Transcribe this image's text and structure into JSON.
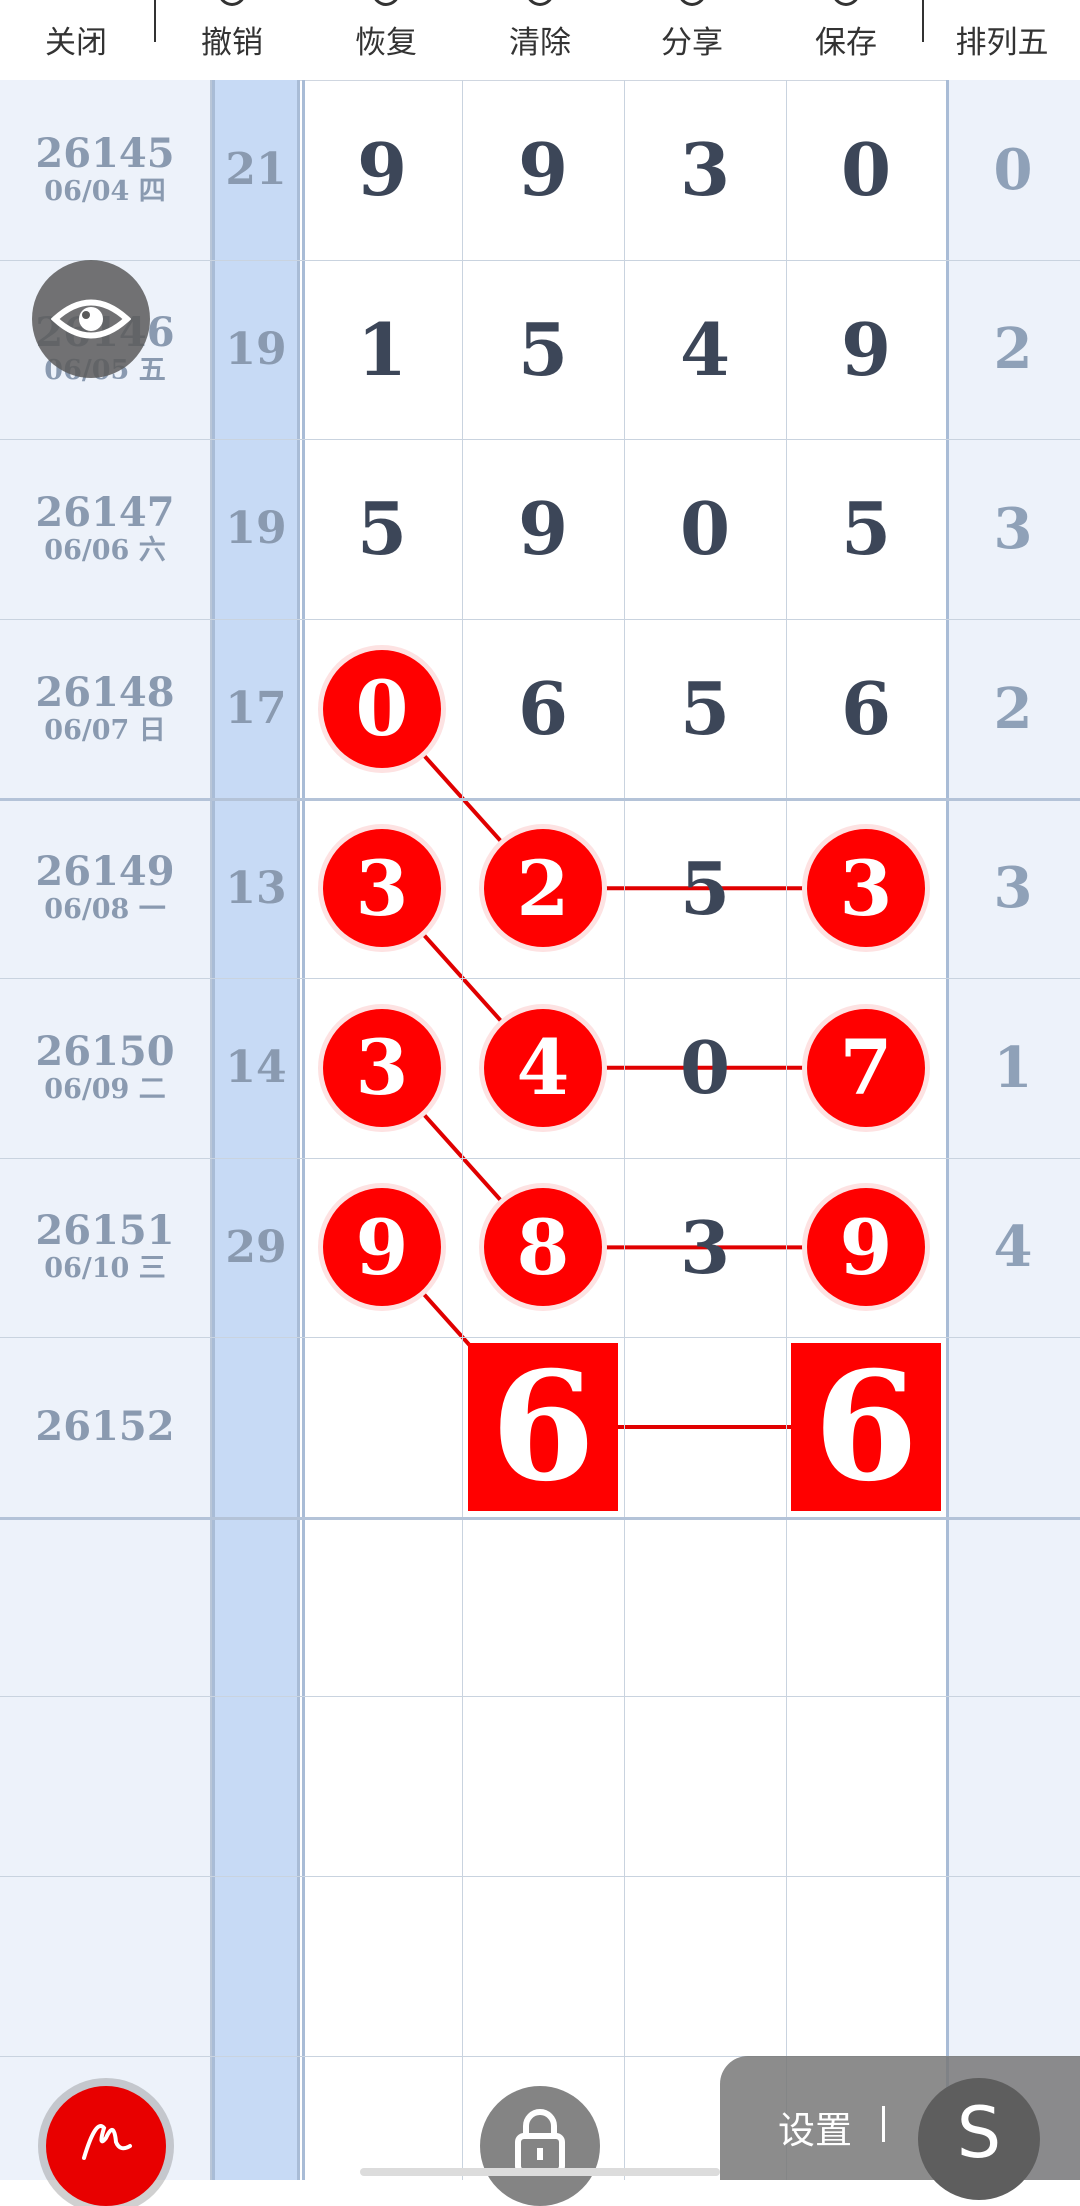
{
  "toolbar": {
    "items": [
      {
        "label": "关闭",
        "icon": "close-icon"
      },
      {
        "label": "撤销",
        "icon": "undo-icon"
      },
      {
        "label": "恢复",
        "icon": "redo-icon"
      },
      {
        "label": "清除",
        "icon": "clear-icon"
      },
      {
        "label": "分享",
        "icon": "share-icon"
      },
      {
        "label": "保存",
        "icon": "save-icon"
      },
      {
        "label": "排列五",
        "icon": ""
      }
    ]
  },
  "rows": [
    {
      "issue": "26145",
      "date": "06/04 四",
      "sum": "21",
      "digits": [
        "9",
        "9",
        "3",
        "0"
      ],
      "fifth": "0",
      "marked": [
        false,
        false,
        false,
        false
      ]
    },
    {
      "issue": "26146",
      "date": "06/05 五",
      "sum": "19",
      "digits": [
        "1",
        "5",
        "4",
        "9"
      ],
      "fifth": "2",
      "marked": [
        false,
        false,
        false,
        false
      ]
    },
    {
      "issue": "26147",
      "date": "06/06 六",
      "sum": "19",
      "digits": [
        "5",
        "9",
        "0",
        "5"
      ],
      "fifth": "3",
      "marked": [
        false,
        false,
        false,
        false
      ]
    },
    {
      "issue": "26148",
      "date": "06/07 日",
      "sum": "17",
      "digits": [
        "0",
        "6",
        "5",
        "6"
      ],
      "fifth": "2",
      "marked": [
        true,
        false,
        false,
        false
      ]
    },
    {
      "issue": "26149",
      "date": "06/08 一",
      "sum": "13",
      "digits": [
        "3",
        "2",
        "5",
        "3"
      ],
      "fifth": "3",
      "marked": [
        true,
        true,
        false,
        true
      ]
    },
    {
      "issue": "26150",
      "date": "06/09 二",
      "sum": "14",
      "digits": [
        "3",
        "4",
        "0",
        "7"
      ],
      "fifth": "1",
      "marked": [
        true,
        true,
        false,
        true
      ]
    },
    {
      "issue": "26151",
      "date": "06/10 三",
      "sum": "29",
      "digits": [
        "9",
        "8",
        "3",
        "9"
      ],
      "fifth": "4",
      "marked": [
        true,
        true,
        false,
        true
      ]
    },
    {
      "issue": "26152",
      "date": "",
      "sum": "",
      "digits": [
        "",
        "6",
        "",
        "6"
      ],
      "fifth": "",
      "marked": [
        false,
        false,
        false,
        false
      ],
      "predicted": [
        false,
        true,
        false,
        true
      ]
    }
  ],
  "controls": {
    "settings_label": "设置",
    "s_label": "S"
  },
  "colors": {
    "accent_red": "#ff0000",
    "sum_column": "#c7daf5",
    "side_column": "#edf2fa"
  }
}
